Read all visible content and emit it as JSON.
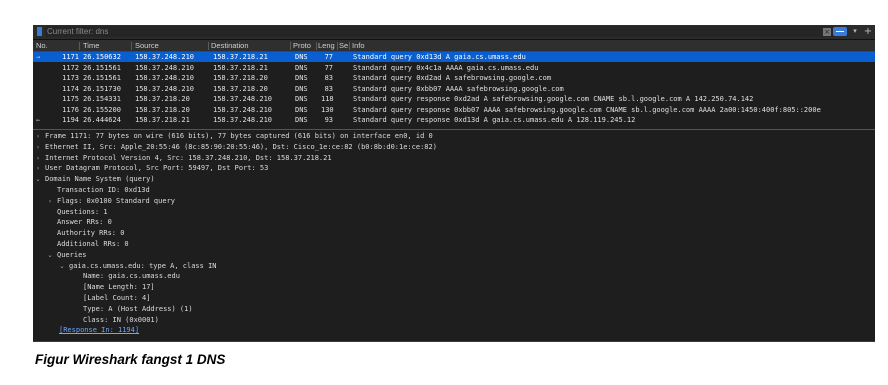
{
  "filter": {
    "placeholder": "Current filter: dns"
  },
  "icons": {
    "filter": "bookmark-icon",
    "clear": "clear-icon",
    "apply": "apply-arrow-icon",
    "dropdown": "chevron-down-icon",
    "add": "plus-icon"
  },
  "columns": {
    "no": "No.",
    "time": "Time",
    "source": "Source",
    "destination": "Destination",
    "protocol": "Proto",
    "length": "Leng",
    "sep": "Se",
    "info": "Info"
  },
  "packets": [
    {
      "no": "1171",
      "time": "26.150632",
      "src": "158.37.248.210",
      "dst": "158.37.218.21",
      "proto": "DNS",
      "len": "77",
      "info": "Standard query 0xd13d A gaia.cs.umass.edu",
      "selected": true
    },
    {
      "no": "1172",
      "time": "26.151561",
      "src": "158.37.248.210",
      "dst": "158.37.218.21",
      "proto": "DNS",
      "len": "77",
      "info": "Standard query 0x4c1a AAAA gaia.cs.umass.edu"
    },
    {
      "no": "1173",
      "time": "26.151561",
      "src": "158.37.248.210",
      "dst": "158.37.218.20",
      "proto": "DNS",
      "len": "83",
      "info": "Standard query 0xd2ad A safebrowsing.google.com"
    },
    {
      "no": "1174",
      "time": "26.151730",
      "src": "158.37.248.210",
      "dst": "158.37.218.20",
      "proto": "DNS",
      "len": "83",
      "info": "Standard query 0xbb07 AAAA safebrowsing.google.com"
    },
    {
      "no": "1175",
      "time": "26.154331",
      "src": "158.37.218.20",
      "dst": "158.37.248.210",
      "proto": "DNS",
      "len": "118",
      "info": "Standard query response 0xd2ad A safebrowsing.google.com CNAME sb.l.google.com A 142.250.74.142"
    },
    {
      "no": "1176",
      "time": "26.155200",
      "src": "158.37.218.20",
      "dst": "158.37.248.210",
      "proto": "DNS",
      "len": "130",
      "info": "Standard query response 0xbb07 AAAA safebrowsing.google.com CNAME sb.l.google.com AAAA 2a00:1450:400f:805::200e"
    },
    {
      "no": "1194",
      "time": "26.444624",
      "src": "158.37.218.21",
      "dst": "158.37.248.210",
      "proto": "DNS",
      "len": "93",
      "info": "Standard query response 0xd13d A gaia.cs.umass.edu A 128.119.245.12"
    }
  ],
  "details": [
    {
      "twisty": "›",
      "text": "Frame 1171: 77 bytes on wire (616 bits), 77 bytes captured (616 bits) on interface en0, id 0"
    },
    {
      "twisty": "›",
      "text": "Ethernet II, Src: Apple_20:55:46 (8c:85:90:20:55:46), Dst: Cisco_1e:ce:82 (b0:8b:d0:1e:ce:82)"
    },
    {
      "twisty": "›",
      "text": "Internet Protocol Version 4, Src: 158.37.248.210, Dst: 158.37.218.21"
    },
    {
      "twisty": "›",
      "text": "User Datagram Protocol, Src Port: 59497, Dst Port: 53"
    },
    {
      "twisty": "⌄",
      "text": "Domain Name System (query)"
    },
    {
      "twisty": "",
      "text": "Transaction ID: 0xd13d"
    },
    {
      "twisty": "›",
      "text": "Flags: 0x0100 Standard query"
    },
    {
      "twisty": "",
      "text": "Questions: 1"
    },
    {
      "twisty": "",
      "text": "Answer RRs: 0"
    },
    {
      "twisty": "",
      "text": "Authority RRs: 0"
    },
    {
      "twisty": "",
      "text": "Additional RRs: 0"
    },
    {
      "twisty": "⌄",
      "text": "Queries"
    },
    {
      "twisty": "⌄",
      "text": "gaia.cs.umass.edu: type A, class IN"
    },
    {
      "twisty": "",
      "text": "Name: gaia.cs.umass.edu"
    },
    {
      "twisty": "",
      "text": "[Name Length: 17]"
    },
    {
      "twisty": "",
      "text": "[Label Count: 4]"
    },
    {
      "twisty": "",
      "text": "Type: A (Host Address) (1)"
    },
    {
      "twisty": "",
      "text": "Class: IN (0x0001)"
    },
    {
      "twisty": "",
      "text": "[Response In: 1194]"
    }
  ],
  "caption": "Figur Wireshark fangst 1 DNS",
  "colors": {
    "background": "#1e1e1e",
    "selected": "#0a5fd0",
    "link": "#6ea6ff"
  }
}
